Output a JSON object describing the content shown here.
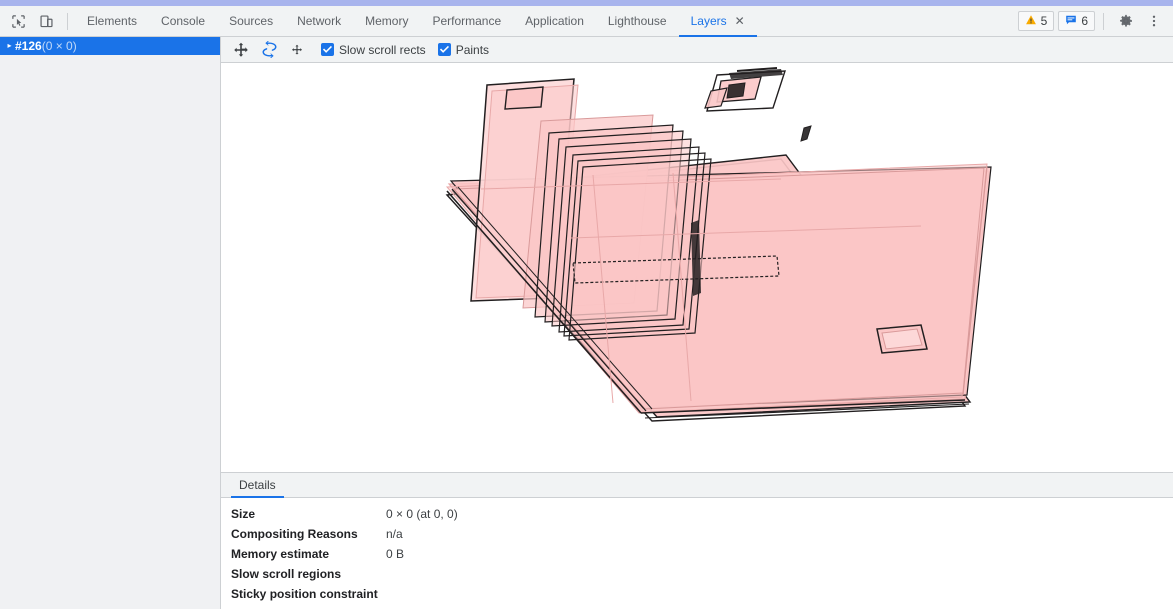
{
  "window": {
    "accent_color": "#a8b4ed",
    "active_color": "#1a73e8"
  },
  "toolbar": {
    "inspect_icon": "inspect-cursor-icon",
    "device_toolbar_icon": "device-toolbar-icon",
    "tabs": [
      {
        "label": "Elements",
        "active": false,
        "closable": false
      },
      {
        "label": "Console",
        "active": false,
        "closable": false
      },
      {
        "label": "Sources",
        "active": false,
        "closable": false
      },
      {
        "label": "Network",
        "active": false,
        "closable": false
      },
      {
        "label": "Memory",
        "active": false,
        "closable": false
      },
      {
        "label": "Performance",
        "active": false,
        "closable": false
      },
      {
        "label": "Application",
        "active": false,
        "closable": false
      },
      {
        "label": "Lighthouse",
        "active": false,
        "closable": false
      },
      {
        "label": "Layers",
        "active": true,
        "closable": true
      }
    ],
    "close_glyph": "✕",
    "warnings": {
      "icon": "warning-triangle-icon",
      "count": "5",
      "color": "#f9ab00"
    },
    "messages": {
      "icon": "message-bubble-icon",
      "count": "6",
      "color": "#1a73e8"
    },
    "settings_icon": "gear-icon",
    "more_icon": "kebab-menu-icon"
  },
  "sidebar": {
    "tree": [
      {
        "twisty": "▸",
        "label": "#126",
        "dimension": "(0 × 0)",
        "selected": true
      }
    ]
  },
  "layers_toolbar": {
    "buttons": [
      {
        "name": "pan-mode-button",
        "icon": "move-arrows-icon",
        "active": false
      },
      {
        "name": "rotate-mode-button",
        "icon": "rotate-3d-icon",
        "active": true
      },
      {
        "name": "reset-view-button",
        "icon": "center-transform-icon",
        "active": false
      }
    ],
    "checkboxes": [
      {
        "label": "Slow scroll rects",
        "checked": true
      },
      {
        "label": "Paints",
        "checked": true
      }
    ]
  },
  "layer_view": {
    "background": "#ffffff",
    "layer_fill": "#fbc6c6",
    "layer_fill_light": "#fdd9d9",
    "layer_stroke": "#221f20",
    "layer_stroke_soft": "#e8a8a8"
  },
  "details": {
    "tabs": [
      {
        "label": "Details",
        "active": true
      }
    ],
    "rows": [
      {
        "key": "Size",
        "value": "0 × 0 (at 0, 0)"
      },
      {
        "key": "Compositing Reasons",
        "value": "n/a"
      },
      {
        "key": "Memory estimate",
        "value": "0 B"
      },
      {
        "key": "Slow scroll regions",
        "value": ""
      },
      {
        "key": "Sticky position constraint",
        "value": ""
      }
    ]
  }
}
